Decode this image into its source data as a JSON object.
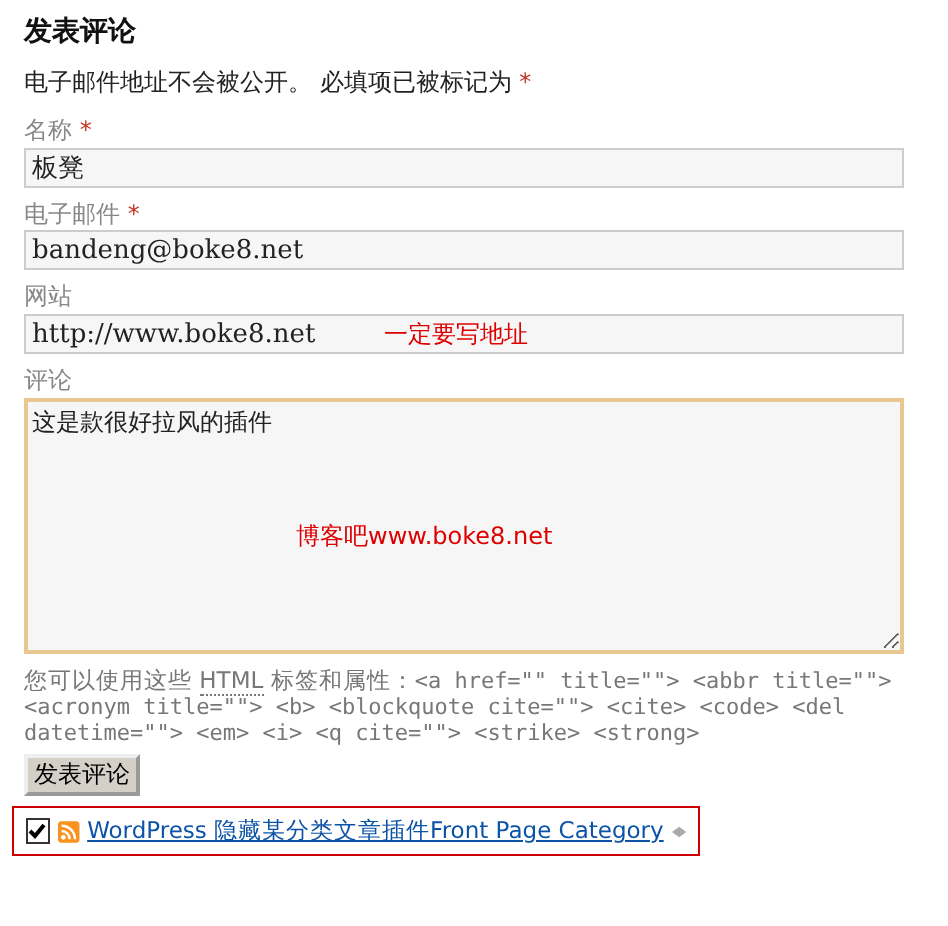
{
  "title": "发表评论",
  "notice": {
    "text": "电子邮件地址不会被公开。 必填项已被标记为",
    "mark": "*"
  },
  "fields": [
    {
      "kind": "input",
      "label": "名称",
      "required": true,
      "value": "板凳",
      "focused": false
    },
    {
      "kind": "input",
      "label": "电子邮件",
      "required": true,
      "value": "bandeng@boke8.net",
      "focused": false
    },
    {
      "kind": "input",
      "label": "网站",
      "required": false,
      "value": "http://www.boke8.net",
      "focused": false,
      "annotation": "一定要写地址"
    },
    {
      "kind": "textarea",
      "label": "评论",
      "required": false,
      "value": "这是款很好拉风的插件",
      "focused": true,
      "annotation": "博客吧www.boke8.net"
    }
  ],
  "help": {
    "before": "您可以使用这些",
    "abbr": "HTML",
    "after": "标签和属性：",
    "code": "<a href=\"\" title=\"\"> <abbr title=\"\"> <acronym title=\"\"> <b> <blockquote cite=\"\"> <cite> <code> <del datetime=\"\"> <em> <i> <q cite=\"\"> <strike> <strong>"
  },
  "submit": "发表评论",
  "subscription": {
    "checked": true,
    "link": "WordPress 隐藏某分类文章插件Front Page Category"
  }
}
